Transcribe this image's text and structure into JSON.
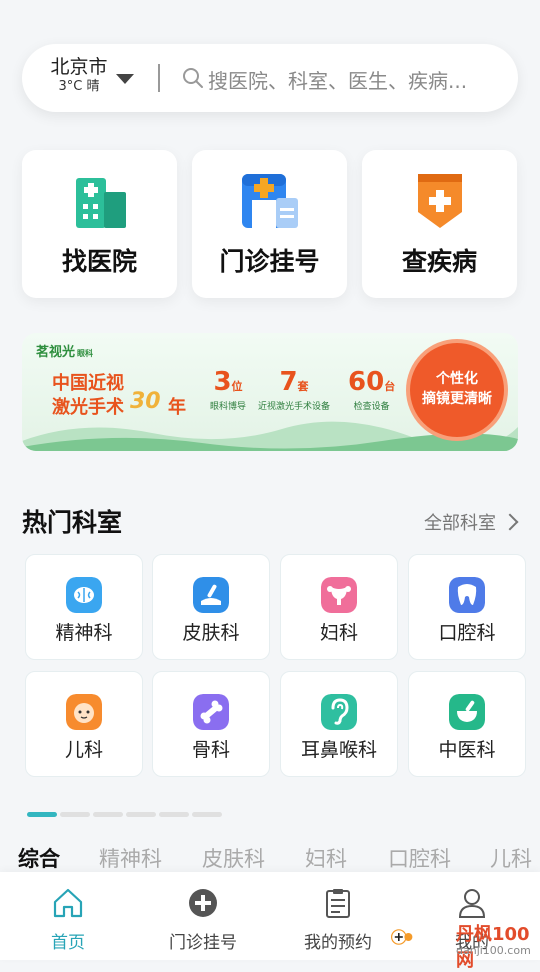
{
  "search": {
    "city": "北京市",
    "weather": "3°C 晴",
    "placeholder": "搜医院、科室、医生、疾病..."
  },
  "quick_actions": [
    {
      "label": "找医院",
      "icon": "hospital-building-icon"
    },
    {
      "label": "门诊挂号",
      "icon": "outpatient-register-icon"
    },
    {
      "label": "查疾病",
      "icon": "disease-check-icon"
    }
  ],
  "banner": {
    "brand": "茗视光",
    "brand_sub": "眼科",
    "headline1": "中国近视",
    "headline2": "激光手术",
    "years": "30",
    "year_suffix": "年",
    "stats": [
      {
        "num": "3",
        "unit": "位",
        "desc": "眼科博导"
      },
      {
        "num": "7",
        "unit": "套",
        "desc": "近视激光手术设备"
      },
      {
        "num": "60",
        "unit": "台",
        "desc": "检查设备"
      }
    ],
    "badge1": "个性化",
    "badge2": "摘镜更清晰"
  },
  "section": {
    "title": "热门科室",
    "more": "全部科室"
  },
  "departments": [
    {
      "label": "精神科",
      "icon": "brain-icon",
      "color": "#3aa6f0"
    },
    {
      "label": "皮肤科",
      "icon": "skin-icon",
      "color": "#2f8fe8"
    },
    {
      "label": "妇科",
      "icon": "uterus-icon",
      "color": "#f06e9a"
    },
    {
      "label": "口腔科",
      "icon": "tooth-icon",
      "color": "#4f7be8"
    },
    {
      "label": "儿科",
      "icon": "baby-icon",
      "color": "#f78b2e"
    },
    {
      "label": "骨科",
      "icon": "bone-icon",
      "color": "#8a6ef0"
    },
    {
      "label": "耳鼻喉科",
      "icon": "ear-icon",
      "color": "#2fbfa0"
    },
    {
      "label": "中医科",
      "icon": "mortar-icon",
      "color": "#25b88a"
    }
  ],
  "tabs": [
    "综合",
    "精神科",
    "皮肤科",
    "妇科",
    "口腔科",
    "儿科"
  ],
  "bottom_nav": [
    {
      "label": "首页",
      "icon": "home-icon",
      "active": true
    },
    {
      "label": "门诊挂号",
      "icon": "plus-circle-icon",
      "active": false
    },
    {
      "label": "我的预约",
      "icon": "clipboard-icon",
      "active": false
    },
    {
      "label": "我的",
      "icon": "user-icon",
      "active": false
    }
  ],
  "watermark": {
    "text": "丹枫100网",
    "url": "danji100.com"
  },
  "colors": {
    "accent": "#27a4b6",
    "banner_orange": "#e8531d",
    "banner_green": "#2f8f3f"
  }
}
